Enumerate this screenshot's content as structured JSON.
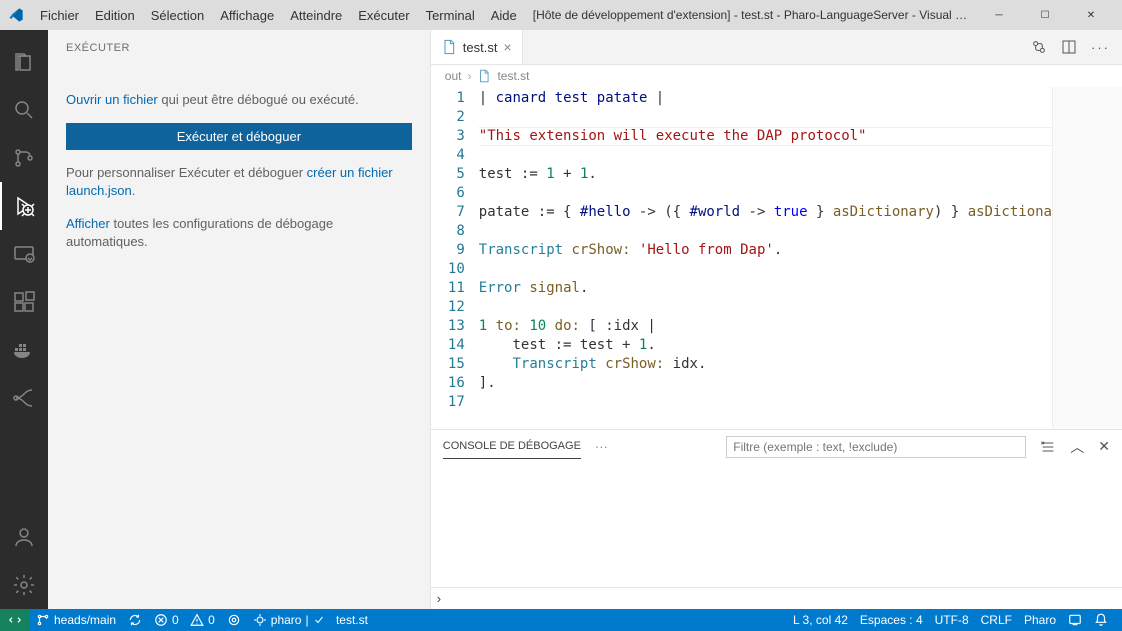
{
  "titlebar": {
    "menu": [
      "Fichier",
      "Edition",
      "Sélection",
      "Affichage",
      "Atteindre",
      "Exécuter",
      "Terminal",
      "Aide"
    ],
    "title": "[Hôte de développement d'extension] - test.st - Pharo-LanguageServer - Visual Studi..."
  },
  "sidebar": {
    "header": "EXÉCUTER",
    "open_link": "Ouvrir un fichier",
    "open_rest": " qui peut être débogué ou exécuté.",
    "button": "Exécuter et déboguer",
    "custom_pre": "Pour personnaliser Exécuter et déboguer ",
    "custom_link": "créer un fichier launch.json",
    "custom_post": ".",
    "show_link": "Afficher",
    "show_rest": " toutes les configurations de débogage automatiques."
  },
  "tab": {
    "filename": "test.st"
  },
  "breadcrumb": {
    "seg1": "out",
    "seg2": "test.st"
  },
  "code": {
    "lines": [
      {
        "n": 1,
        "html": "| <span class='tok-var'>canard</span> <span class='tok-var'>test</span> <span class='tok-var'>patate</span> |"
      },
      {
        "n": 2,
        "html": ""
      },
      {
        "n": 3,
        "html": "<span class='tok-str'>\"This extension will execute the DAP protocol\"</span>"
      },
      {
        "n": 4,
        "html": ""
      },
      {
        "n": 5,
        "html": "test := <span class='tok-num'>1</span> + <span class='tok-num'>1</span>."
      },
      {
        "n": 6,
        "html": ""
      },
      {
        "n": 7,
        "html": "patate := { <span class='tok-sym'>#hello</span> -> ({ <span class='tok-sym'>#world</span> -> <span class='tok-kw'>true</span> } <span class='tok-meth'>asDictionary</span>) } <span class='tok-meth'>asDictiona</span>"
      },
      {
        "n": 8,
        "html": ""
      },
      {
        "n": 9,
        "html": "<span class='tok-cls'>Transcript</span> <span class='tok-meth'>crShow:</span> <span class='tok-str'>'Hello from Dap'</span>."
      },
      {
        "n": 10,
        "html": ""
      },
      {
        "n": 11,
        "html": "<span class='tok-cls'>Error</span> <span class='tok-meth'>signal</span>."
      },
      {
        "n": 12,
        "html": ""
      },
      {
        "n": 13,
        "html": "<span class='tok-num'>1</span> <span class='tok-meth'>to:</span> <span class='tok-num'>10</span> <span class='tok-meth'>do:</span> [ :idx |"
      },
      {
        "n": 14,
        "html": "    test := test + <span class='tok-num'>1</span>."
      },
      {
        "n": 15,
        "html": "    <span class='tok-cls'>Transcript</span> <span class='tok-meth'>crShow:</span> idx."
      },
      {
        "n": 16,
        "html": "]."
      },
      {
        "n": 17,
        "html": ""
      }
    ],
    "highlight_line": 3
  },
  "panel": {
    "tab": "CONSOLE DE DÉBOGAGE",
    "filter_placeholder": "Filtre (exemple : text, !exclude)"
  },
  "status": {
    "branch": "heads/main",
    "errors": "0",
    "warnings": "0",
    "pharo": "pharo",
    "file": "test.st",
    "ln": "L 3, col 42",
    "spaces": "Espaces : 4",
    "encoding": "UTF-8",
    "eol": "CRLF",
    "lang": "Pharo"
  }
}
